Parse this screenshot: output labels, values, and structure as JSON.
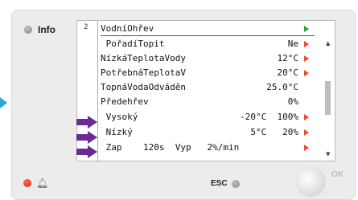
{
  "panel": {
    "info_label": "Info",
    "esc_label": "ESC",
    "ok_label": "OK"
  },
  "screen": {
    "page_number": "2",
    "title": "VodníOhřev",
    "rows": [
      {
        "label": " PořadíTopit",
        "value": "Ne",
        "arrow": true
      },
      {
        "label": "NízkáTeplotaVody",
        "value": "12°C",
        "arrow": true
      },
      {
        "label": "PotřebnáTeplotaV",
        "value": "20°C",
        "arrow": true
      },
      {
        "label": "TopnáVodaOdváděn",
        "value": "25.0°C",
        "arrow": false
      },
      {
        "label": "Předehřev",
        "value": "0%",
        "arrow": false
      },
      {
        "label": " Vysoký",
        "value": "-20°C  100%",
        "arrow": true
      },
      {
        "label": " Nízký",
        "value": "5°C   20%",
        "arrow": true
      },
      {
        "label": " Zap    120s  Vyp   2%/min",
        "value": "",
        "arrow": true
      }
    ]
  },
  "colors": {
    "accent_purple": "#6a2b97",
    "arrow_red": "#e8502a",
    "arrow_green": "#2da02d",
    "led_red": "#d41e10",
    "side_arrow_blue": "#2ea8d8"
  }
}
